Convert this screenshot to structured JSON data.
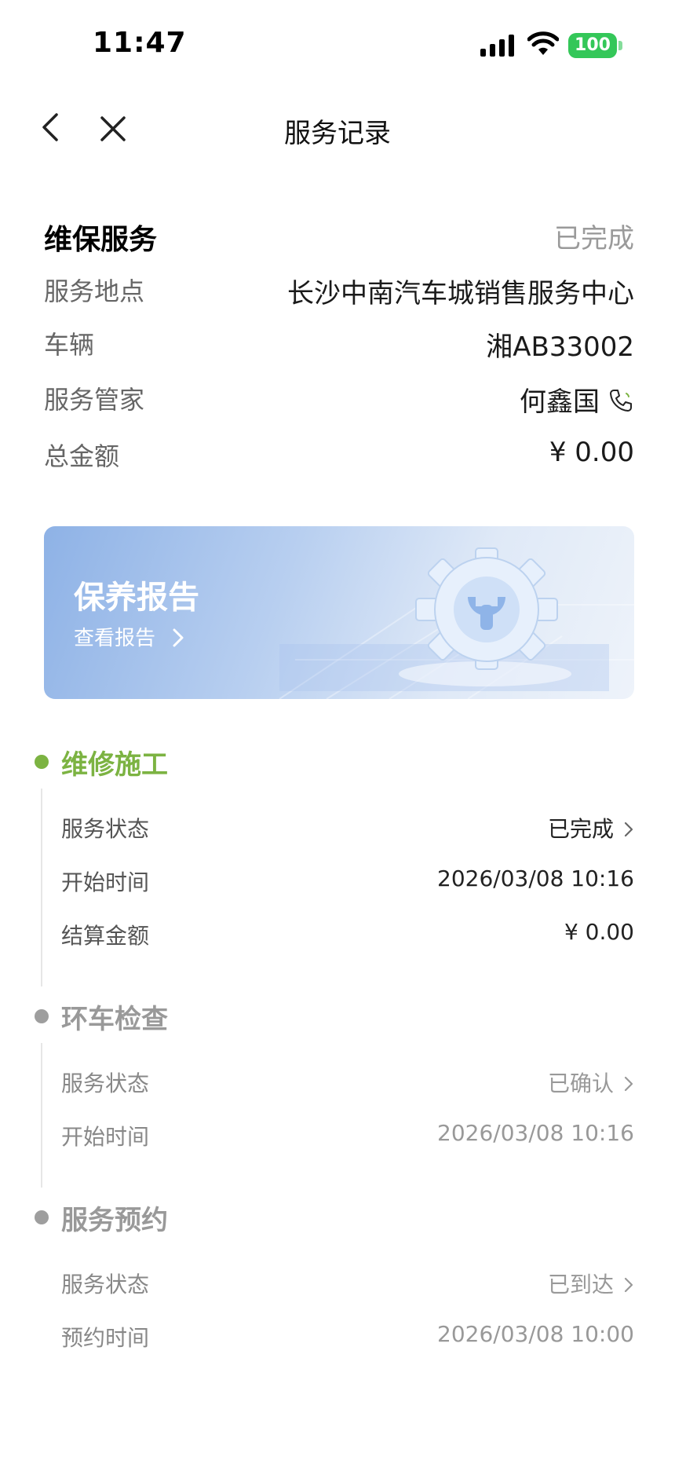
{
  "status_bar": {
    "time": "11:47",
    "battery": "100"
  },
  "nav": {
    "title": "服务记录"
  },
  "summary": {
    "service_type": "维保服务",
    "status": "已完成",
    "rows": [
      {
        "label": "服务地点",
        "value": "长沙中南汽车城销售服务中心"
      },
      {
        "label": "车辆",
        "value": "湘AB33002"
      },
      {
        "label": "服务管家",
        "value": "何鑫国"
      },
      {
        "label": "总金额",
        "value": "¥ 0.00"
      }
    ]
  },
  "banner": {
    "title": "保养报告",
    "link": "查看报告"
  },
  "timeline": [
    {
      "title": "维修施工",
      "color": "#7cb342",
      "rows": [
        {
          "label": "服务状态",
          "value": "已完成"
        },
        {
          "label": "开始时间",
          "value": "2026/03/08 10:16"
        },
        {
          "label": "结算金额",
          "value": "¥  0.00"
        }
      ]
    },
    {
      "title": "环车检查",
      "color": "#9e9e9e",
      "rows": [
        {
          "label": "服务状态",
          "value": "已确认"
        },
        {
          "label": "开始时间",
          "value": "2026/03/08 10:16"
        }
      ]
    },
    {
      "title": "服务预约",
      "color": "#9e9e9e",
      "rows": [
        {
          "label": "服务状态",
          "value": "已到达"
        },
        {
          "label": "预约时间",
          "value": "2026/03/08 10:00"
        }
      ]
    }
  ]
}
